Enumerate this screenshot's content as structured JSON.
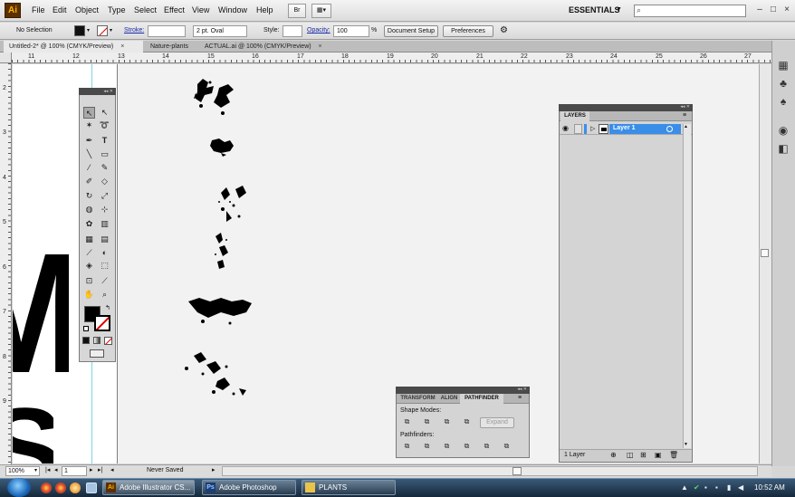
{
  "app": {
    "logo": "Ai",
    "menus": [
      "File",
      "Edit",
      "Object",
      "Type",
      "Select",
      "Effect",
      "View",
      "Window",
      "Help"
    ],
    "workspace": "ESSENTIALS",
    "search_placeholder": ""
  },
  "control_bar": {
    "selection_state": "No Selection",
    "stroke_label": "Stroke:",
    "brush": "2 pt. Oval",
    "style_label": "Style:",
    "opacity_label": "Opacity:",
    "opacity_value": "100",
    "opacity_unit": "%",
    "document_setup": "Document Setup",
    "preferences": "Preferences"
  },
  "tabs": [
    {
      "label": "Untitled-2* @ 100% (CMYK/Preview)",
      "close": "×"
    },
    {
      "label": "Nature-plants"
    },
    {
      "label": "ACTUAL.ai @ 100% (CMYK/Preview)",
      "close": "×"
    }
  ],
  "rulers": {
    "top": [
      "11",
      "12",
      "13",
      "14",
      "15",
      "16",
      "17",
      "18",
      "19",
      "20",
      "21",
      "22",
      "23",
      "24",
      "25",
      "26",
      "27"
    ],
    "left": [
      "2",
      "3",
      "4",
      "5",
      "6",
      "7",
      "8",
      "9"
    ]
  },
  "canvas_text": {
    "letter_m": "M",
    "letter_s": "S"
  },
  "layers_panel": {
    "tab": "LAYERS",
    "layer_name": "Layer 1",
    "footer": "1 Layer"
  },
  "pathfinder_panel": {
    "tabs": [
      "TRANSFORM",
      "ALIGN",
      "PATHFINDER"
    ],
    "shape_modes_label": "Shape Modes:",
    "pathfinders_label": "Pathfinders:",
    "expand_label": "Expand"
  },
  "status_bar": {
    "zoom": "100%",
    "artboard": "1",
    "save_state": "Never Saved"
  },
  "taskbar": {
    "items": [
      "Adobe Illustrator CS...",
      "Adobe Photoshop",
      "PLANTS"
    ],
    "clock": "10:52 AM"
  },
  "colors": {
    "layer_highlight": "#3a8ee8",
    "guide": "#79d7e6",
    "logo_bg": "#5a3000"
  }
}
